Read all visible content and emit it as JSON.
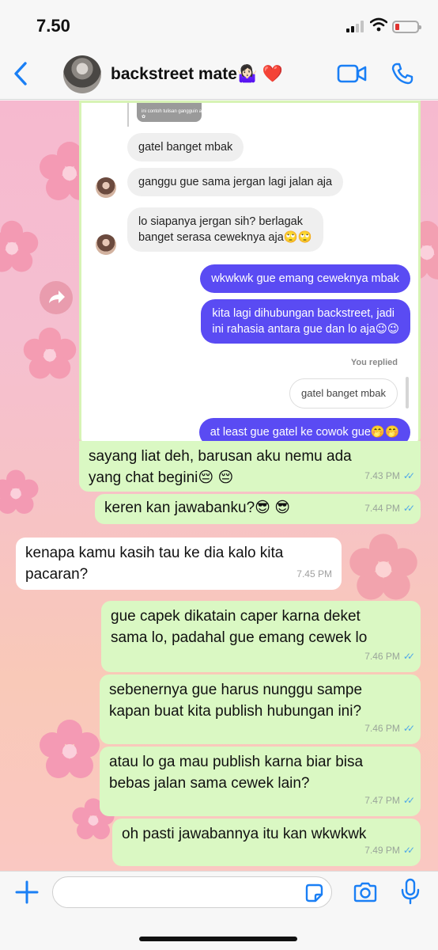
{
  "status_bar": {
    "time": "7.50"
  },
  "header": {
    "contact_name": "backstreet mate🤷🏻‍♀️ ❤️"
  },
  "embedded_screenshot": {
    "top_image_caption": "ini contoh tulisan gangguin aja ✿",
    "messages": [
      {
        "side": "in",
        "text": "gatel banget mbak"
      },
      {
        "side": "in",
        "text": "ganggu gue sama jergan lagi jalan aja"
      },
      {
        "side": "in",
        "line1": "lo siapanya jergan sih? berlagak",
        "line2": "banget serasa ceweknya aja🙄🙄"
      },
      {
        "side": "out",
        "text": "wkwkwk gue emang ceweknya mbak"
      },
      {
        "side": "out",
        "line1": "kita lagi dihubungan backstreet, jadi",
        "line2": "ini rahasia antara gue dan lo aja😉😉"
      },
      {
        "side": "note",
        "text": "You replied"
      },
      {
        "side": "reply",
        "text": "gatel banget mbak"
      },
      {
        "side": "out",
        "text": "at least gue gatel ke cowok gue🤭🤭"
      }
    ]
  },
  "messages": [
    {
      "side": "out",
      "line1": "sayang liat deh, barusan aku nemu ada",
      "line2": "yang chat begini😔 😔",
      "time": "7.43 PM"
    },
    {
      "side": "out",
      "line1": "keren kan jawabanku?😎 😎",
      "time": "7.44 PM"
    },
    {
      "side": "in",
      "line1": "kenapa kamu kasih tau ke dia kalo kita",
      "line2": "pacaran?",
      "time": "7.45 PM"
    },
    {
      "side": "out",
      "line1": "gue capek dikatain caper karna deket",
      "line2": "sama lo, padahal gue emang cewek lo",
      "time": "7.46 PM"
    },
    {
      "side": "out",
      "line1": "sebenernya gue harus nunggu sampe",
      "line2": "kapan buat kita publish hubungan ini?",
      "time": "7.46 PM"
    },
    {
      "side": "out",
      "line1": "atau lo ga mau publish karna biar bisa",
      "line2": "bebas jalan sama cewek lain?",
      "time": "7.47 PM"
    },
    {
      "side": "out",
      "line1": "oh pasti jawabannya itu kan wkwkwk",
      "time": "7.49 PM"
    }
  ],
  "input": {
    "placeholder": "",
    "value": ""
  },
  "icons": {
    "back": "chevron-left-icon",
    "video": "video-camera-icon",
    "call": "phone-icon",
    "forward": "forward-arrow-icon",
    "plus": "plus-icon",
    "sticker": "sticker-icon",
    "camera": "camera-icon",
    "mic": "microphone-icon"
  },
  "colors": {
    "ios_blue": "#1a7ff5",
    "outgoing_bubble": "#daf8c3",
    "incoming_bubble": "#ffffff",
    "instagram_outgoing": "#5a4bf3",
    "read_tick": "#4fa8e8",
    "wallpaper_pink": "#f6b9cf"
  }
}
